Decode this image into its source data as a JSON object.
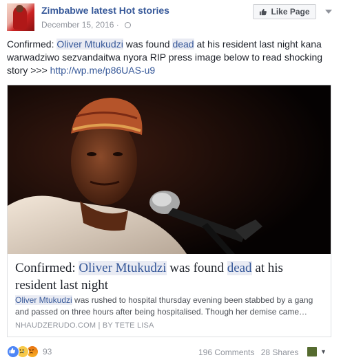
{
  "header": {
    "page_name": "Zimbabwe latest Hot stories",
    "date": "December 15, 2016",
    "like_page_label": "Like Page"
  },
  "post": {
    "text_parts": {
      "p1": "Confirmed: ",
      "h1": "Oliver Mtukudzi",
      "p2": " was found ",
      "h2": "dead",
      "p3": " at his resident last night kana warwadziwo sezvandaitwa nyora RIP press image below to read shocking story >>> ",
      "link": "http://wp.me/p86UAS-u9"
    }
  },
  "card": {
    "title_parts": {
      "p1": "Confirmed: ",
      "h1": "Oliver Mtukudzi",
      "p2": " was found ",
      "h2": "dead",
      "p3": " at his resident last night"
    },
    "desc_parts": {
      "h1": "Oliver Mtukudzi",
      "p1": " was rushed to hospital thursday evening been stabbed by a gang and passed on three hours after being hospitalised. Though her demise came…"
    },
    "source": "NHAUDZERUDO.COM | BY TETE LISA"
  },
  "footer": {
    "reaction_count": "93",
    "comments": "196 Comments",
    "shares": "28 Shares"
  },
  "colors": {
    "link": "#365899",
    "highlight": "#e9ebf3",
    "muted": "#90949c"
  }
}
